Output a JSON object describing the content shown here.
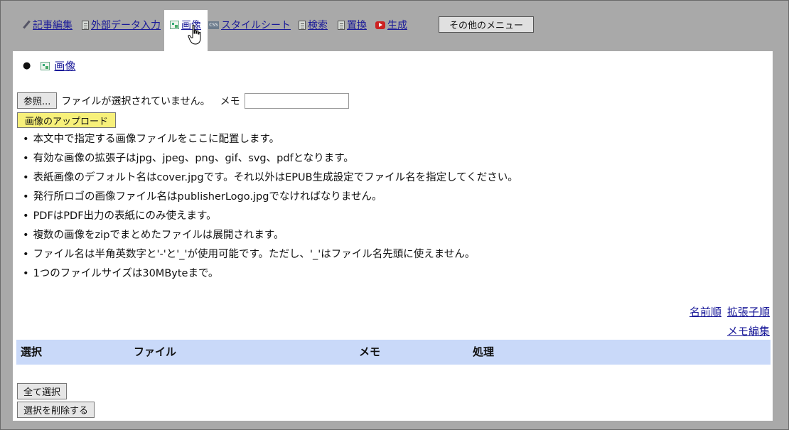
{
  "nav": {
    "items": [
      {
        "label": "記事編集",
        "icon": "pencil-icon"
      },
      {
        "label": "外部データ入力",
        "icon": "document-icon"
      },
      {
        "label": "画像",
        "icon": "image-icon",
        "active": true
      },
      {
        "label": "スタイルシート",
        "icon": "css-icon"
      },
      {
        "label": "検索",
        "icon": "document-icon"
      },
      {
        "label": "置換",
        "icon": "document-icon"
      },
      {
        "label": "生成",
        "icon": "youtube-icon"
      }
    ],
    "more_menu_label": "その他のメニュー"
  },
  "panel": {
    "section_link": "画像",
    "browse_button": "参照...",
    "file_status": "ファイルが選択されていません。",
    "memo_label": "メモ",
    "memo_value": "",
    "upload_button": "画像のアップロード",
    "notes": [
      "本文中で指定する画像ファイルをここに配置します。",
      "有効な画像の拡張子はjpg、jpeg、png、gif、svg、pdfとなります。",
      "表紙画像のデフォルト名はcover.jpgです。それ以外はEPUB生成設定でファイル名を指定してください。",
      "発行所ロゴの画像ファイル名はpublisherLogo.jpgでなければなりません。",
      "PDFはPDF出力の表紙にのみ使えます。",
      "複数の画像をzipでまとめたファイルは展開されます。",
      "ファイル名は半角英数字と'-'と'_'が使用可能です。ただし、'_'はファイル名先頭に使えません。",
      "1つのファイルサイズは30MByteまで。"
    ],
    "sort_by_name": "名前順",
    "sort_by_extension": "拡張子順",
    "memo_edit": "メモ編集",
    "table_headers": [
      "選択",
      "ファイル",
      "メモ",
      "処理"
    ],
    "select_all_button": "全て選択",
    "delete_selected_button": "選択を削除する"
  },
  "colors": {
    "background": "#a9a9a9",
    "link": "#1a1a99",
    "table_header_bg": "#c9d9f9",
    "upload_button_bg": "#f7f07a"
  }
}
